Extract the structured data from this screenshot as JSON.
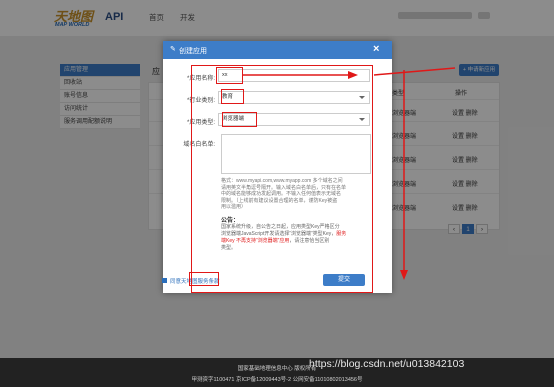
{
  "header": {
    "logo_cn": "天地图",
    "logo_en": "MAP WORLD",
    "api_label": "API",
    "nav": [
      "首页",
      "开发"
    ]
  },
  "sidebar": {
    "items": [
      {
        "label": "应用管理",
        "active": true
      },
      {
        "label": "回收站",
        "active": false
      },
      {
        "label": "账号信息",
        "active": false
      },
      {
        "label": "访问统计",
        "active": false
      },
      {
        "label": "服务调用配额说明",
        "active": false
      }
    ]
  },
  "content": {
    "title": "应",
    "apply_button": "+ 申请新应用",
    "table": {
      "headers": [
        "类型",
        "操作"
      ],
      "rows": [
        {
          "type": "浏览器端",
          "actions": "设置  删除"
        },
        {
          "type": "浏览器端",
          "actions": "设置  删除"
        },
        {
          "type": "浏览器端",
          "actions": "设置  删除"
        },
        {
          "type": "浏览器端",
          "actions": "设置  删除"
        },
        {
          "type": "浏览器端",
          "actions": "设置  删除"
        }
      ]
    },
    "pager": {
      "prev": "‹",
      "page": "1",
      "next": "›"
    }
  },
  "modal": {
    "title": "创建应用",
    "close": "×",
    "fields": {
      "app_name": {
        "label": "*应用名称:",
        "value": "xx"
      },
      "industry": {
        "label": "*行业类别:",
        "value": "教育"
      },
      "app_type": {
        "label": "*应用类型:",
        "value": "浏览器端"
      },
      "whitelist": {
        "label": "域名白名单:"
      }
    },
    "help": [
      "格式：www.myapi.com,www.myapp.com 多个域名之间",
      "请用英文半角逗号隔开。输入域名白名单后，只有在名单",
      "中的域名能够成功发起调用。不输入任何值表示无域名",
      "限制。（上线前有建议设置合理的名单，谨防Key被盗",
      "用以滥用）"
    ],
    "notice_title": "公告：",
    "notice": {
      "line1": "国家系统升级，自公告之日起，应用类型Key严格区分",
      "line2": "浏览器端JavaScript开发请选择“浏览器端”类型Key，",
      "line2_red": "服务",
      "line3_red": "端Key 不再支持“浏览器端”应用",
      "line3": "，请注意恰当区别",
      "line4": "类型。"
    },
    "agree_text": "同意天地图服务条款",
    "submit": "提交"
  },
  "footer": {
    "line1": "国家基础地理信息中心  版权所有",
    "line2": "甲测资字1100471  京ICP备12009443号-2  公网安备11010802013456号"
  },
  "watermark": "https://blog.csdn.net/u013842103",
  "colors": {
    "primary": "#3d7dc8",
    "annotation": "#e01818"
  }
}
